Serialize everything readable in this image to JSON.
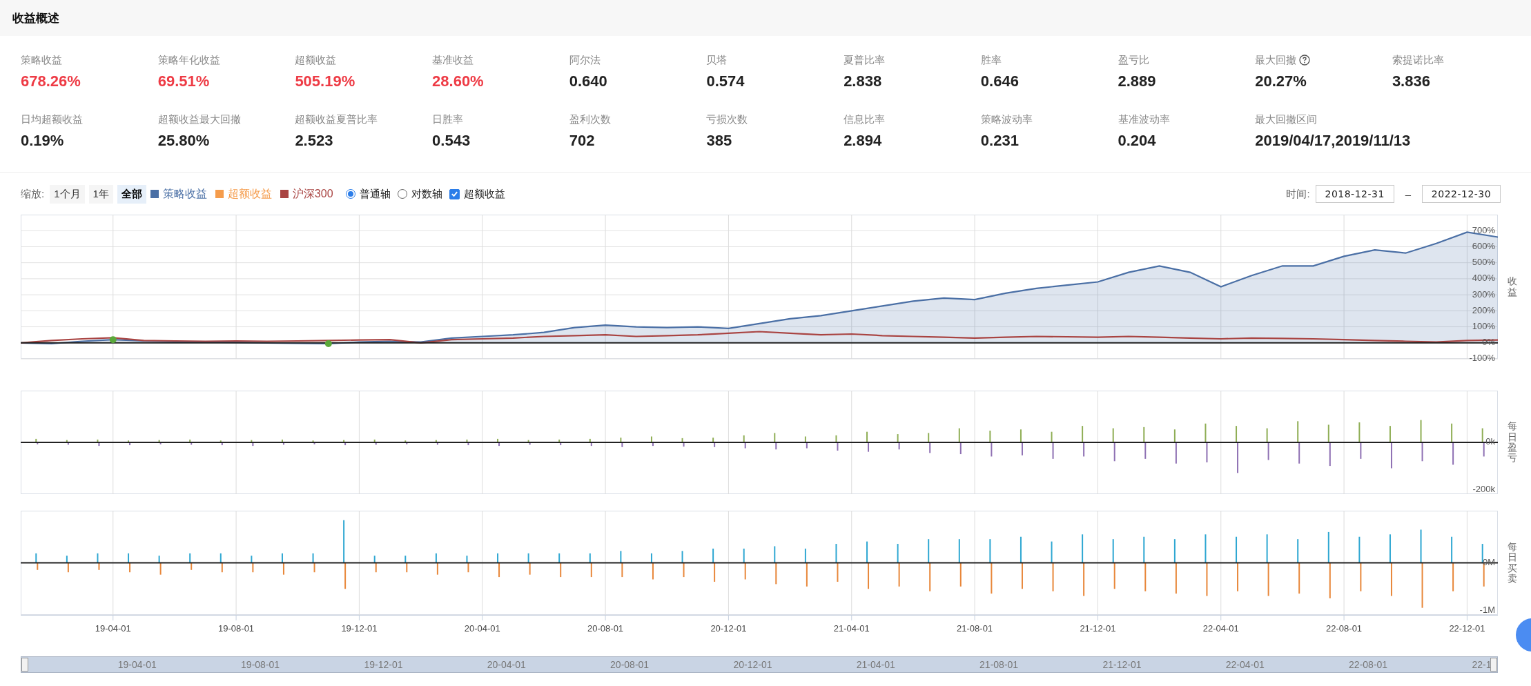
{
  "section_title": "收益概述",
  "metrics": [
    {
      "label": "策略收益",
      "value": "678.26%",
      "highlight": true,
      "help": false
    },
    {
      "label": "策略年化收益",
      "value": "69.51%",
      "highlight": true,
      "help": false
    },
    {
      "label": "超额收益",
      "value": "505.19%",
      "highlight": true,
      "help": false
    },
    {
      "label": "基准收益",
      "value": "28.60%",
      "highlight": true,
      "help": false
    },
    {
      "label": "阿尔法",
      "value": "0.640",
      "highlight": false,
      "help": false
    },
    {
      "label": "贝塔",
      "value": "0.574",
      "highlight": false,
      "help": false
    },
    {
      "label": "夏普比率",
      "value": "2.838",
      "highlight": false,
      "help": false
    },
    {
      "label": "胜率",
      "value": "0.646",
      "highlight": false,
      "help": false
    },
    {
      "label": "盈亏比",
      "value": "2.889",
      "highlight": false,
      "help": false
    },
    {
      "label": "最大回撤",
      "value": "20.27%",
      "highlight": false,
      "help": true
    },
    {
      "label": "索提诺比率",
      "value": "3.836",
      "highlight": false,
      "help": false
    },
    {
      "label": "日均超额收益",
      "value": "0.19%",
      "highlight": false,
      "help": false
    },
    {
      "label": "超额收益最大回撤",
      "value": "25.80%",
      "highlight": false,
      "help": false
    },
    {
      "label": "超额收益夏普比率",
      "value": "2.523",
      "highlight": false,
      "help": false
    },
    {
      "label": "日胜率",
      "value": "0.543",
      "highlight": false,
      "help": false
    },
    {
      "label": "盈利次数",
      "value": "702",
      "highlight": false,
      "help": false
    },
    {
      "label": "亏损次数",
      "value": "385",
      "highlight": false,
      "help": false
    },
    {
      "label": "信息比率",
      "value": "2.894",
      "highlight": false,
      "help": false
    },
    {
      "label": "策略波动率",
      "value": "0.231",
      "highlight": false,
      "help": false
    },
    {
      "label": "基准波动率",
      "value": "0.204",
      "highlight": false,
      "help": false
    },
    {
      "label": "最大回撤区间",
      "value": "2019/04/17,2019/11/13",
      "highlight": false,
      "help": false
    }
  ],
  "toolbar": {
    "zoom_label": "缩放:",
    "zoom_buttons": [
      {
        "label": "1个月",
        "selected": false
      },
      {
        "label": "1年",
        "selected": false
      },
      {
        "label": "全部",
        "selected": true
      }
    ],
    "legend": [
      {
        "label": "策略收益",
        "color": "#4a6fa5"
      },
      {
        "label": "超额收益",
        "color": "#f59c4c"
      },
      {
        "label": "沪深300",
        "color": "#a94442"
      }
    ],
    "axis_modes": [
      {
        "label": "普通轴",
        "selected": true
      },
      {
        "label": "对数轴",
        "selected": false
      }
    ],
    "excess_toggle": {
      "label": "超额收益",
      "checked": true
    },
    "time_label": "时间:",
    "start_date": "2018-12-31",
    "separator": "–",
    "end_date": "2022-12-30"
  },
  "charts": [
    {
      "chart_data": {
        "type": "area",
        "ylabel": "收益",
        "grid": true,
        "ylim": [
          -100,
          800
        ],
        "yticks": [
          {
            "value": 700,
            "label": "700%"
          },
          {
            "value": 600,
            "label": "600%"
          },
          {
            "value": 500,
            "label": "500%"
          },
          {
            "value": 400,
            "label": "400%"
          },
          {
            "value": 300,
            "label": "300%"
          },
          {
            "value": 200,
            "label": "200%"
          },
          {
            "value": 100,
            "label": "100%"
          },
          {
            "value": 0,
            "label": "0%"
          },
          {
            "value": -100,
            "label": "-100%"
          }
        ],
        "series": [
          {
            "type": "area",
            "color": "#4a6fa5",
            "values": [
              0,
              -5,
              10,
              20,
              12,
              8,
              5,
              3,
              0,
              -3,
              -5,
              5,
              10,
              5,
              30,
              40,
              50,
              65,
              95,
              110,
              100,
              95,
              100,
              90,
              120,
              150,
              170,
              200,
              230,
              260,
              280,
              270,
              310,
              340,
              360,
              380,
              440,
              480,
              440,
              350,
              420,
              480,
              480,
              540,
              580,
              560,
              620,
              690,
              660
            ]
          },
          {
            "type": "line",
            "color": "#a94442",
            "values": [
              0,
              15,
              25,
              32,
              15,
              12,
              10,
              12,
              10,
              12,
              15,
              18,
              20,
              0,
              20,
              25,
              30,
              40,
              45,
              50,
              40,
              45,
              50,
              60,
              70,
              60,
              50,
              55,
              45,
              40,
              35,
              30,
              35,
              40,
              38,
              35,
              40,
              35,
              30,
              25,
              30,
              28,
              25,
              20,
              15,
              10,
              5,
              15,
              18
            ]
          },
          {
            "type": "scatter",
            "color": "#5aa83a",
            "values": [
              null,
              null,
              null,
              20,
              null,
              null,
              null,
              null,
              null,
              null,
              -5,
              null,
              null,
              null,
              null,
              null,
              null,
              null,
              null,
              null,
              null,
              null,
              null,
              null,
              null,
              null,
              null,
              null,
              null,
              null,
              null,
              null,
              null,
              null,
              null,
              null,
              null,
              null,
              null,
              null,
              null,
              null,
              null,
              null,
              null,
              null,
              null,
              null,
              null
            ]
          }
        ]
      }
    },
    {
      "chart_data": {
        "type": "bar",
        "ylabel": "每日盈亏",
        "grid": true,
        "ylim": [
          -220,
          220
        ],
        "yticks": [
          {
            "value": 0,
            "label": "0k"
          },
          {
            "value": -200,
            "label": "-200k"
          }
        ],
        "series": [
          {
            "color": "#8fae55",
            "values": [
              15,
              10,
              12,
              8,
              10,
              12,
              8,
              10,
              12,
              8,
              10,
              12,
              8,
              10,
              12,
              15,
              10,
              12,
              15,
              20,
              25,
              18,
              20,
              30,
              40,
              25,
              30,
              45,
              35,
              40,
              60,
              50,
              55,
              45,
              70,
              60,
              65,
              55,
              80,
              70,
              60,
              90,
              75,
              85,
              70,
              95,
              80,
              60
            ]
          },
          {
            "color": "#8e70b3",
            "values": [
              -8,
              -10,
              -15,
              -12,
              -8,
              -10,
              -12,
              -15,
              -10,
              -8,
              -12,
              -10,
              -8,
              -10,
              -12,
              -15,
              -10,
              -12,
              -15,
              -20,
              -15,
              -18,
              -20,
              -25,
              -30,
              -25,
              -35,
              -40,
              -30,
              -45,
              -50,
              -60,
              -55,
              -70,
              -60,
              -80,
              -70,
              -90,
              -85,
              -130,
              -75,
              -90,
              -100,
              -70,
              -110,
              -80,
              -95,
              -60
            ]
          }
        ]
      }
    },
    {
      "chart_data": {
        "type": "bar",
        "ylabel": "每日买卖",
        "grid": true,
        "ylim": [
          -1.1,
          1.1
        ],
        "yticks": [
          {
            "value": 0,
            "label": "0M"
          },
          {
            "value": -1,
            "label": "-1M"
          }
        ],
        "series": [
          {
            "color": "#2ea7d2",
            "values": [
              0.2,
              0.15,
              0.2,
              0.2,
              0.15,
              0.2,
              0.2,
              0.15,
              0.2,
              0.2,
              0.9,
              0.15,
              0.15,
              0.2,
              0.15,
              0.2,
              0.2,
              0.2,
              0.2,
              0.25,
              0.2,
              0.25,
              0.3,
              0.3,
              0.35,
              0.3,
              0.4,
              0.45,
              0.4,
              0.5,
              0.5,
              0.5,
              0.55,
              0.45,
              0.6,
              0.5,
              0.55,
              0.5,
              0.6,
              0.55,
              0.6,
              0.5,
              0.65,
              0.55,
              0.6,
              0.7,
              0.55,
              0.4
            ]
          },
          {
            "color": "#e8873a",
            "values": [
              -0.15,
              -0.2,
              -0.15,
              -0.2,
              -0.25,
              -0.15,
              -0.2,
              -0.2,
              -0.25,
              -0.2,
              -0.55,
              -0.2,
              -0.2,
              -0.25,
              -0.2,
              -0.3,
              -0.25,
              -0.3,
              -0.3,
              -0.3,
              -0.35,
              -0.3,
              -0.4,
              -0.35,
              -0.45,
              -0.5,
              -0.4,
              -0.55,
              -0.5,
              -0.6,
              -0.5,
              -0.65,
              -0.55,
              -0.6,
              -0.7,
              -0.55,
              -0.6,
              -0.65,
              -0.7,
              -0.6,
              -0.7,
              -0.65,
              -0.75,
              -0.6,
              -0.7,
              -0.95,
              -0.6,
              -0.5
            ]
          }
        ]
      }
    }
  ],
  "x_axis_labels": [
    "19-04-01",
    "19-08-01",
    "19-12-01",
    "20-04-01",
    "20-08-01",
    "20-12-01",
    "21-04-01",
    "21-08-01",
    "21-12-01",
    "22-04-01",
    "22-08-01",
    "22-12-01"
  ],
  "navigator": {
    "labels": [
      "19-04-01",
      "19-08-01",
      "19-12-01",
      "20-04-01",
      "20-08-01",
      "20-12-01",
      "21-04-01",
      "21-08-01",
      "21-12-01",
      "22-04-01",
      "22-08-01",
      "22-1"
    ]
  }
}
